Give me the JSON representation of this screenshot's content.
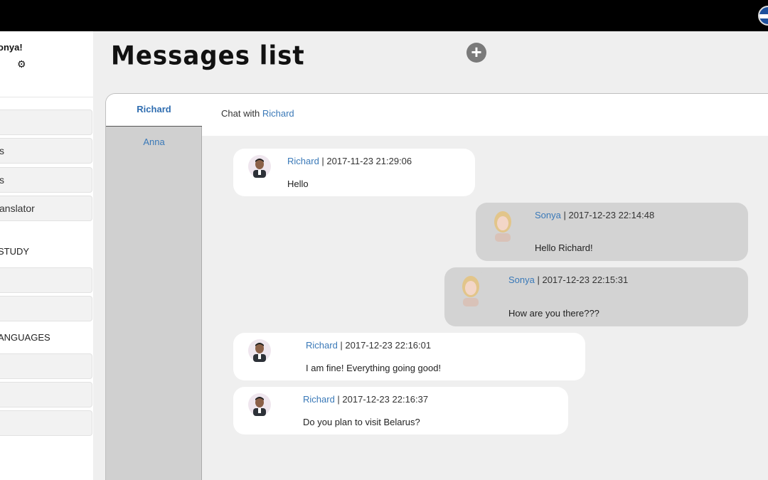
{
  "sidebar": {
    "greeting": "onya!",
    "nav_items": [
      "",
      "s",
      "s",
      "anslator"
    ],
    "section_study": "STUDY",
    "study_items": [
      "",
      ""
    ],
    "section_languages": "ANGUAGES",
    "language_items": [
      "",
      "",
      ""
    ]
  },
  "header": {
    "title": "Messages list",
    "add_icon": "plus-circle-icon"
  },
  "contacts": [
    {
      "name": "Richard"
    },
    {
      "name": "Anna"
    }
  ],
  "chat": {
    "prefix": "Chat with",
    "contact": "Richard"
  },
  "messages": [
    {
      "author": "Richard",
      "stamp": " | 2017-11-23 21:29:06",
      "text": "Hello"
    },
    {
      "author": "Sonya",
      "stamp": " | 2017-12-23 22:14:48",
      "text": "Hello Richard!"
    },
    {
      "author": "Sonya",
      "stamp": " | 2017-12-23 22:15:31",
      "text": "How are you there???"
    },
    {
      "author": "Richard",
      "stamp": " | 2017-12-23 22:16:01",
      "text": "I am fine! Everything going good!"
    },
    {
      "author": "Richard",
      "stamp": " | 2017-12-23 22:16:37",
      "text": "Do you plan to visit Belarus?"
    }
  ],
  "colors": {
    "accent_link": "#3a79b8",
    "topbar": "#000000",
    "incoming_bubble": "#ffffff",
    "outgoing_bubble": "#d3d3d3"
  }
}
